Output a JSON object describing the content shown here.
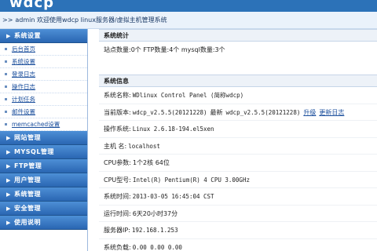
{
  "header": {
    "logo_text": "wdcp",
    "welcome_arrows": ">>",
    "welcome_text": "admin 欢迎使用wdcp linux服务器/虚拟主机管理系统"
  },
  "sidebar": {
    "first_section": "系统设置",
    "sub_items": [
      "后台首页",
      "系统设置",
      "登录日志",
      "操作日志",
      "计划任务",
      "邮件设置",
      "memcached设置"
    ],
    "sections": [
      "网站管理",
      "MYSQL管理",
      "FTP管理",
      "用户管理",
      "系统管理",
      "安全管理",
      "使用说明"
    ]
  },
  "stats": {
    "title": "系统统计",
    "line": "站点数量:0个   FTP数量:4个   mysql数量:3个"
  },
  "info": {
    "title": "系统信息",
    "system_name_label": "系统名称:",
    "system_name": "WDlinux Control Panel (简称wdcp)",
    "current_version_label": "当前版本:",
    "current_version": "wdcp_v2.5.5(20121228)",
    "latest_label": "最新",
    "latest_version": "wdcp_v2.5.5(20121228)",
    "upgrade_link": "升级",
    "changelog_link": "更新日志",
    "os_label": "操作系统:",
    "os": "Linux 2.6.18-194.el5xen",
    "host_label": "主机 名:",
    "host": "localhost",
    "cpu_params_label": "CPU参数:",
    "cpu_params": "1个2核 64位",
    "cpu_model_label": "CPU型号:",
    "cpu_model": "Intel(R) Pentium(R) 4 CPU 3.00GHz",
    "system_time_label": "系统时间:",
    "system_time": "2013-03-05 16:45:04 CST",
    "uptime_label": "运行时间:",
    "uptime": "6天20小时37分",
    "server_ip_label": "服务器IP:",
    "server_ip": "192.168.1.253",
    "load_label": "系统负载:",
    "load": "0.00   0.00   0.00"
  },
  "colors": {
    "topbar": "#2c72b8",
    "menu_head": "#2a66b2",
    "link": "#1a4e9c"
  }
}
